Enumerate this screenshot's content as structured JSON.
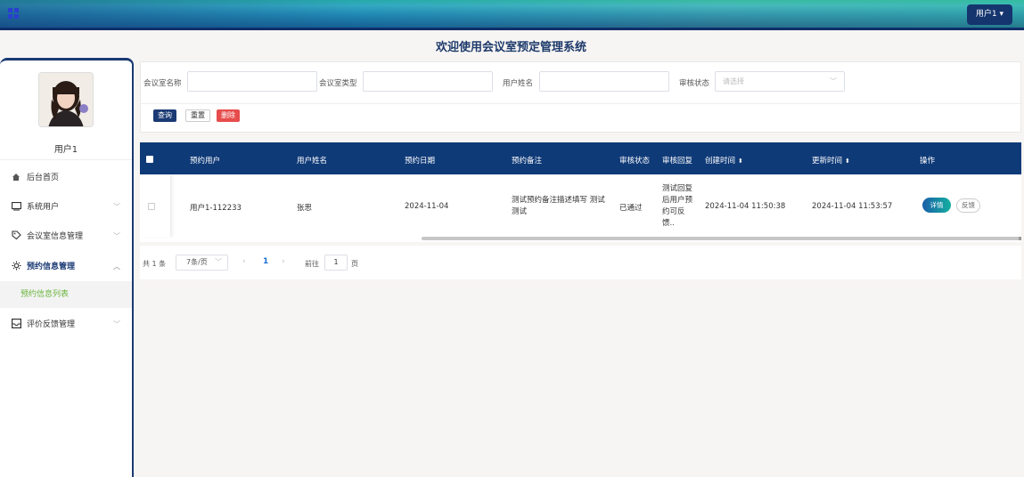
{
  "header": {
    "user_button": "用户1 ▾"
  },
  "page_title": "欢迎使用会议室预定管理系统",
  "sidebar": {
    "username": "用户1",
    "items": [
      {
        "label": "后台首页",
        "icon": "home-icon"
      },
      {
        "label": "系统用户",
        "icon": "monitor-icon"
      },
      {
        "label": "会议室信息管理",
        "icon": "tag-icon"
      },
      {
        "label": "预约信息管理",
        "icon": "gear-icon"
      },
      {
        "label": "评价反馈管理",
        "icon": "inbox-icon"
      }
    ],
    "sub_item": "预约信息列表"
  },
  "search": {
    "room_name_label": "会议室名称",
    "room_type_label": "会议室类型",
    "user_name_label": "用户姓名",
    "status_label": "审核状态",
    "status_placeholder": "请选择",
    "query_button": "查询",
    "reset_button": "重置",
    "delete_button": "删除"
  },
  "table": {
    "headers": [
      "预约用户",
      "用户姓名",
      "预约日期",
      "预约备注",
      "审核状态",
      "审核回复",
      "创建时间",
      "更新时间",
      "操作"
    ],
    "rows": [
      {
        "user": "用户1-112233",
        "name": "张思",
        "date": "2024-11-04",
        "remark": "测试预约备注描述填写 测试测试",
        "status": "已通过",
        "reply": "测试回复后用户预约可反馈..",
        "created": "2024-11-04 11:50:38",
        "updated": "2024-11-04 11:53:57",
        "detail_button": "详情",
        "feedback_button": "反馈"
      }
    ]
  },
  "pagination": {
    "total": "共 1 条",
    "page_size": "7条/页",
    "current_page": "1",
    "goto_label": "前往",
    "goto_value": "1",
    "page_suffix": "页"
  }
}
